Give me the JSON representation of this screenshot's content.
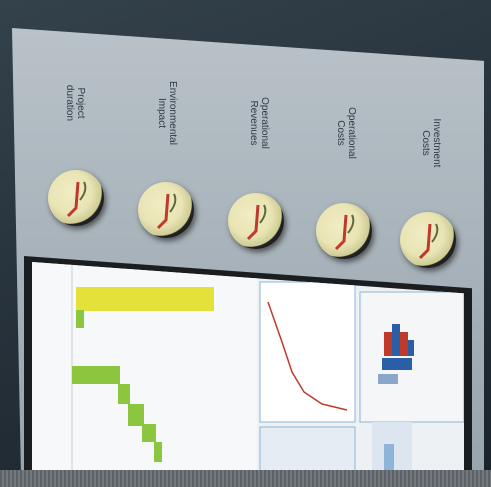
{
  "labels": [
    {
      "text": "Project\nduration"
    },
    {
      "text": "Environmental\nImpact"
    },
    {
      "text": "Operational\nRevenues"
    },
    {
      "text": "Operational\nCosts"
    },
    {
      "text": "Investment\nCosts"
    }
  ],
  "colors": {
    "panel": "#aab4bb",
    "knob_face": "#ece8bb",
    "needle": "#c0392b",
    "gantt_yellow": "#e4e23a",
    "gantt_green": "#8cc63f",
    "chart_red": "#c0392b",
    "chart_blue": "#2a5fa8"
  }
}
